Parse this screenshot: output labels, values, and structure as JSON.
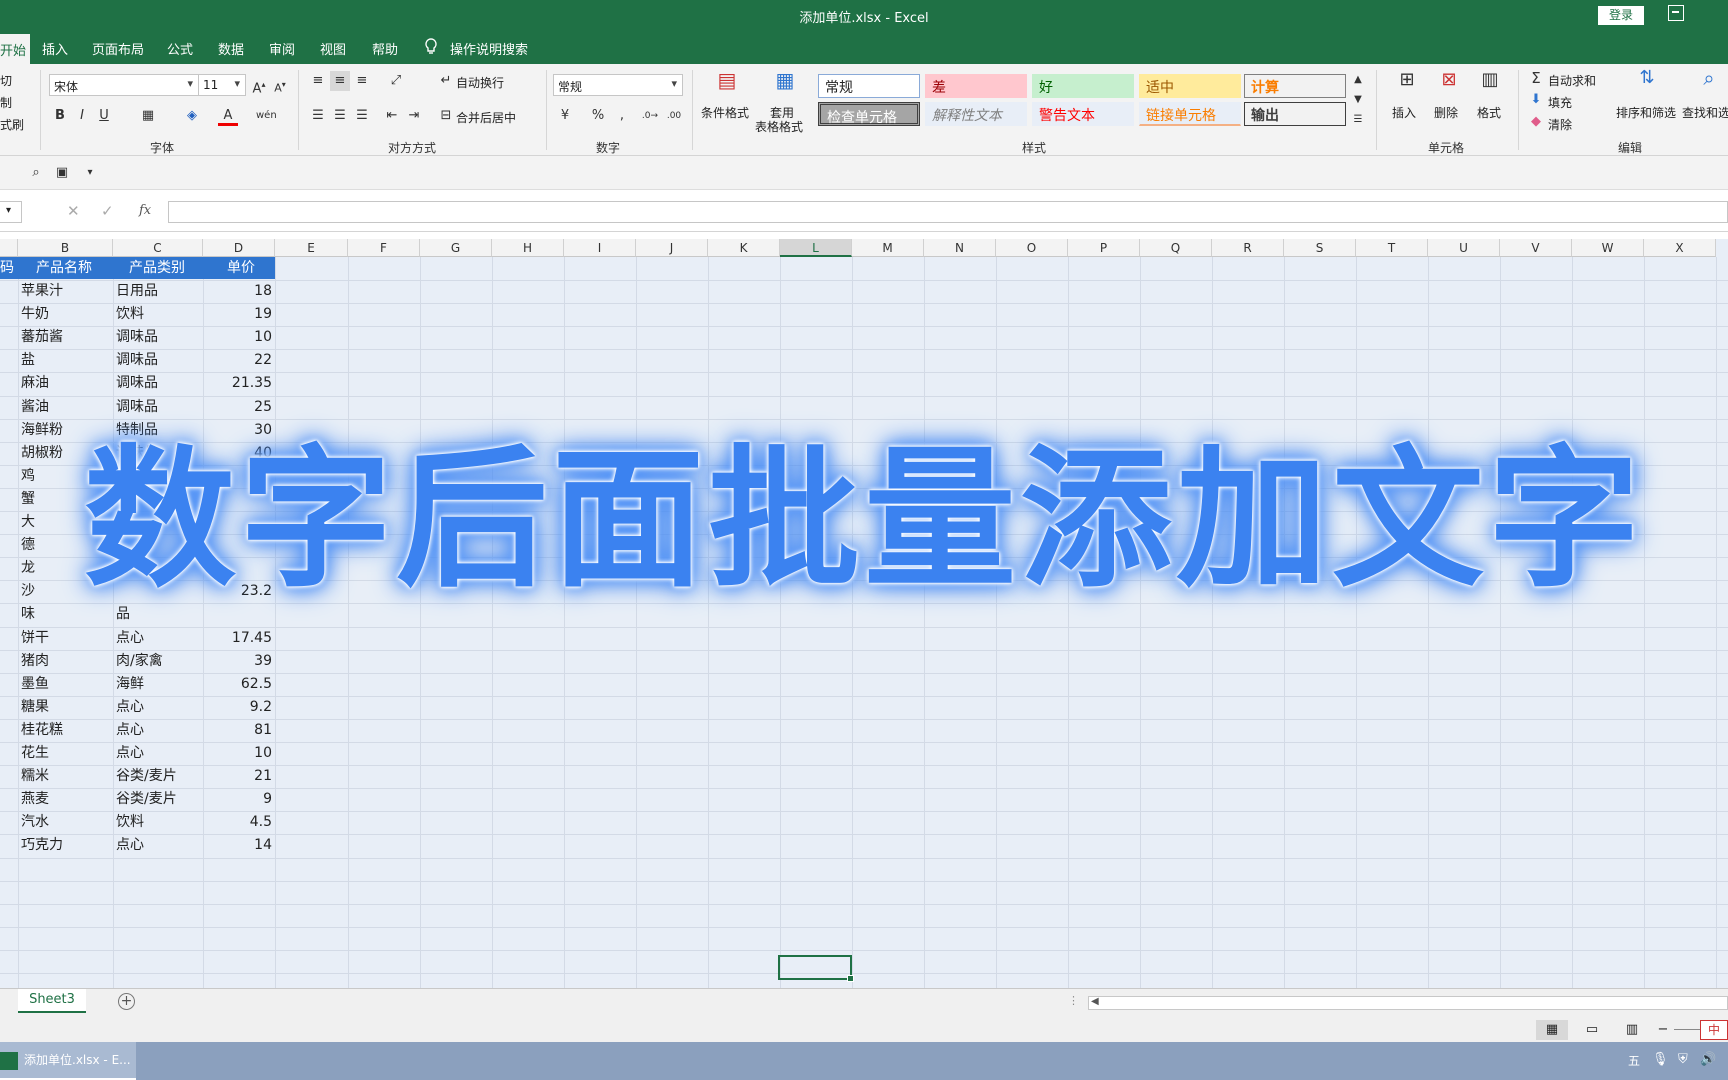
{
  "window": {
    "title": "添加单位.xlsx  -  Excel",
    "login": "登录"
  },
  "tabs": [
    "开始",
    "插入",
    "页面布局",
    "公式",
    "数据",
    "审阅",
    "视图",
    "帮助"
  ],
  "search_tab": "操作说明搜索",
  "ribbon": {
    "clipboard": {
      "cut": "切",
      "copy": "制",
      "painter": "式刷"
    },
    "font": {
      "name": "宋体",
      "size": "11",
      "group": "字体"
    },
    "align": {
      "wrap": "自动换行",
      "merge": "合并后居中",
      "group": "对方方式"
    },
    "number": {
      "format": "常规",
      "percent": "%",
      "comma": ",",
      "group": "数字"
    },
    "styles": {
      "cond_format": "条件格式",
      "table_format_1": "套用",
      "table_format_2": "表格格式",
      "cells": [
        {
          "label": "常规",
          "bg": "#ffffff",
          "color": "#222222",
          "border": "#8aaad8"
        },
        {
          "label": "差",
          "bg": "#ffc7ce",
          "color": "#9c0006",
          "border": "#ffc7ce"
        },
        {
          "label": "好",
          "bg": "#c6efce",
          "color": "#006100",
          "border": "#c6efce"
        },
        {
          "label": "适中",
          "bg": "#ffeb9c",
          "color": "#9c5700",
          "border": "#ffeb9c"
        },
        {
          "label": "计算",
          "bg": "#f2f2f2",
          "color": "#fa7d00",
          "border": "#7f7f7f"
        },
        {
          "label": "检查单元格",
          "bg": "#a5a5a5",
          "color": "#ffffff",
          "border": "#3f3f3f"
        },
        {
          "label": "解释性文本",
          "bg": "#e8eef7",
          "color": "#7f7f7f",
          "border": "#e8eef7"
        },
        {
          "label": "警告文本",
          "bg": "#e8eef7",
          "color": "#ff0000",
          "border": "#e8eef7"
        },
        {
          "label": "链接单元格",
          "bg": "#e8eef7",
          "color": "#fa7d00",
          "border": "#e8eef7"
        },
        {
          "label": "输出",
          "bg": "#f2f2f2",
          "color": "#3f3f3f",
          "border": "#3f3f3f"
        }
      ],
      "group": "样式"
    },
    "cells_grp": {
      "insert": "插入",
      "delete": "删除",
      "format": "格式",
      "group": "单元格"
    },
    "editing": {
      "autosum": "自动求和",
      "fill": "填充",
      "clear": "清除",
      "sort": "排序和筛选",
      "find": "查找和选",
      "group": "编辑"
    }
  },
  "formula_bar": {
    "fx": "fx",
    "value": ""
  },
  "grid": {
    "columns": [
      "B",
      "C",
      "D",
      "E",
      "F",
      "G",
      "H",
      "I",
      "J",
      "K",
      "L",
      "M",
      "N",
      "O",
      "P",
      "Q",
      "R",
      "S",
      "T",
      "U",
      "V",
      "W",
      "X"
    ],
    "selected_column": "L",
    "header_row": {
      "a": "码",
      "b": "产品名称",
      "c": "产品类别",
      "d": "单价"
    },
    "rows": [
      {
        "b": "苹果汁",
        "c": "日用品",
        "d": "18"
      },
      {
        "b": "牛奶",
        "c": "饮料",
        "d": "19"
      },
      {
        "b": "蕃茄酱",
        "c": "调味品",
        "d": "10"
      },
      {
        "b": "盐",
        "c": "调味品",
        "d": "22"
      },
      {
        "b": "麻油",
        "c": "调味品",
        "d": "21.35"
      },
      {
        "b": "酱油",
        "c": "调味品",
        "d": "25"
      },
      {
        "b": "海鲜粉",
        "c": "特制品",
        "d": "30"
      },
      {
        "b": "胡椒粉",
        "c": "调味品",
        "d": "40"
      },
      {
        "b": "鸡",
        "c": "肉/家禽",
        "d": ""
      },
      {
        "b": "蟹",
        "c": "",
        "d": ""
      },
      {
        "b": "大",
        "c": "",
        "d": ""
      },
      {
        "b": "德",
        "c": "",
        "d": ""
      },
      {
        "b": "龙",
        "c": "海",
        "d": ""
      },
      {
        "b": "沙",
        "c": "",
        "d": "23.2"
      },
      {
        "b": "味",
        "c": "品",
        "d": ""
      },
      {
        "b": "饼干",
        "c": "点心",
        "d": "17.45"
      },
      {
        "b": "猪肉",
        "c": "肉/家禽",
        "d": "39"
      },
      {
        "b": "墨鱼",
        "c": "海鲜",
        "d": "62.5"
      },
      {
        "b": "糖果",
        "c": "点心",
        "d": "9.2"
      },
      {
        "b": "桂花糕",
        "c": "点心",
        "d": "81"
      },
      {
        "b": "花生",
        "c": "点心",
        "d": "10"
      },
      {
        "b": "糯米",
        "c": "谷类/麦片",
        "d": "21"
      },
      {
        "b": "燕麦",
        "c": "谷类/麦片",
        "d": "9"
      },
      {
        "b": "汽水",
        "c": "饮料",
        "d": "4.5"
      },
      {
        "b": "巧克力",
        "c": "点心",
        "d": "14"
      }
    ]
  },
  "sheet_tab": "Sheet3",
  "overlay_caption": "数字后面批量添加文字",
  "taskbar": {
    "app_label": "添加单位.xlsx - E...",
    "ime": "五",
    "ime2": "中"
  },
  "colors": {
    "brand": "#1f7145",
    "header_fill": "#2f75cf",
    "overlay_text": "#3b82f0"
  }
}
